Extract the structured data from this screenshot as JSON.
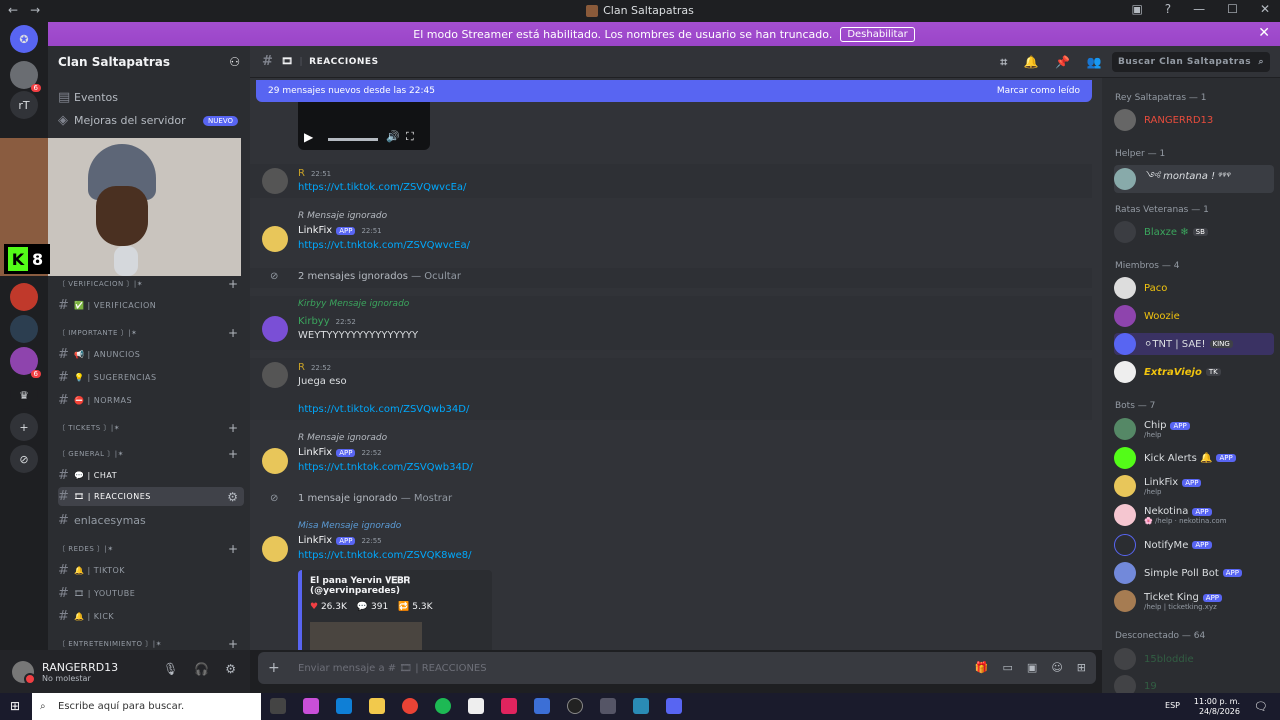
{
  "window": {
    "title": "Clan Saltapatras",
    "back": "←",
    "forward": "→"
  },
  "banner": {
    "text": "El modo Streamer está habilitado. Los nombres de usuario se han truncado.",
    "button": "Deshabilitar"
  },
  "guilds": [
    {
      "label": "rT"
    },
    {
      "label": "8"
    }
  ],
  "server": {
    "name": "Clan Saltapatras",
    "events": "Eventos",
    "boosts": "Mejoras del servidor",
    "boosts_badge": "NUEVO"
  },
  "channels": [
    {
      "kind": "category",
      "label": "〔 VERIFICACION 〕|✶"
    },
    {
      "kind": "channel",
      "label": "✅ | VERIFICACION"
    },
    {
      "kind": "category",
      "label": "〔 IMPORTANTE 〕|✶"
    },
    {
      "kind": "channel",
      "label": "📢 | ANUNCIOS"
    },
    {
      "kind": "channel",
      "label": "💡 | SUGERENCIAS"
    },
    {
      "kind": "channel",
      "label": "⛔ | NORMAS"
    },
    {
      "kind": "category",
      "label": "〔 TICKETS 〕|✶"
    },
    {
      "kind": "category",
      "label": "〔 GENERAL 〕|✶"
    },
    {
      "kind": "channel",
      "label": "💬 | CHAT"
    },
    {
      "kind": "channel",
      "label": "🎞 | REACCIONES"
    },
    {
      "kind": "channel",
      "label": "enlacesymas"
    },
    {
      "kind": "category",
      "label": "〔 REDES 〕|✶"
    },
    {
      "kind": "channel",
      "label": "🔔 | TIKTOK"
    },
    {
      "kind": "channel",
      "label": "🎞 | YOUTUBE"
    },
    {
      "kind": "channel",
      "label": "🔔 | KICK"
    },
    {
      "kind": "category",
      "label": "〔 ENTRETENIMIENTO 〕|✶"
    }
  ],
  "user": {
    "name": "RANGERRD13",
    "status": "No molestar"
  },
  "channel": {
    "name": "REACCIONES",
    "search_placeholder": "Buscar Clan Saltapatras"
  },
  "newbar": {
    "text": "29 mensajes nuevos desde las 22:45",
    "action": "Marcar como leído"
  },
  "messages": [
    {
      "author": "R",
      "time": "22:51",
      "link": "https://vt.tiktok.com/ZSVQwvcEa/"
    },
    {
      "reply": "R Mensaje ignorado",
      "author": "LinkFix",
      "tag": "APP",
      "time": "22:51",
      "link": "https://vt.tnktok.com/ZSVQwvcEa/"
    },
    {
      "ignored": "2 mensajes ignorados",
      "action": "— Ocultar"
    },
    {
      "reply": "Kirbyy Mensaje ignorado",
      "author": "Kirbyy",
      "time": "22:52",
      "text": "WEYTYYYYYYYYYYYYYYY"
    },
    {
      "author": "R",
      "time": "22:52",
      "text": "Juega eso",
      "link": "https://vt.tiktok.com/ZSVQwb34D/"
    },
    {
      "reply": "R Mensaje ignorado",
      "author": "LinkFix",
      "tag": "APP",
      "time": "22:52",
      "link": "https://vt.tnktok.com/ZSVQwb34D/"
    },
    {
      "ignored": "1 mensaje ignorado",
      "action": "— Mostrar"
    },
    {
      "reply": "Misa Mensaje ignorado",
      "author": "LinkFix",
      "tag": "APP",
      "time": "22:55",
      "link": "https://vt.tnktok.com/ZSVQK8we8/"
    }
  ],
  "embed": {
    "author": "El pana Yervin 𝐕𝐄𝐁𝐑 (@yervinparedes)",
    "likes": "26.3K",
    "comments": "391",
    "shares": "5.3K"
  },
  "input": {
    "placeholder": "Enviar mensaje a # 🎞 | REACCIONES"
  },
  "members": {
    "cat1": "Rey Saltapatras — 1",
    "m1": "RANGERRD13",
    "cat2": "Helper — 1",
    "m2": "༺ montana ! ᵠᵠᵠ",
    "cat3": "Ratas Veteranas — 1",
    "m3": "Blaxze ❄",
    "m3tag": "SB",
    "cat4": "Miembros — 4",
    "m4": "Paco",
    "m5": "Woozie",
    "m6": "⚪TNT | SAE!",
    "m6tag": "KING",
    "m7": "ExtraViejo",
    "m7tag": "TK",
    "cat5": "Bots — 7",
    "b1": "Chip",
    "b1sub": "/help",
    "b2": "Kick Alerts 🔔",
    "b3": "LinkFix",
    "b3sub": "/help",
    "b4": "Nekotina",
    "b4sub": "🌸 /help · nekotina.com",
    "b5": "NotifyMe",
    "b6": "Simple Poll Bot",
    "b7": "Ticket King",
    "b7sub": "/help | ticketking.xyz",
    "cat6": "Desconectado — 64",
    "o1": "15bloddie",
    "o2": "19",
    "apptag": "APP"
  },
  "taskbar": {
    "search": "Escribe aquí para buscar.",
    "lang": "ESP",
    "time": "11:00 p. m.",
    "date": "24/8/2026"
  }
}
